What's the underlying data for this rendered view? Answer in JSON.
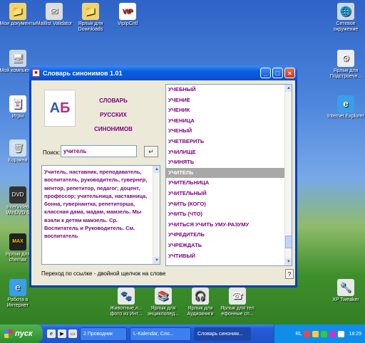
{
  "desktop": {
    "icons": [
      {
        "label": "Мои документы",
        "icon": "folder-icon"
      },
      {
        "label": "Maillist Validator",
        "icon": "app-icon"
      },
      {
        "label": "Ярлык для Downloads",
        "icon": "folder-icon"
      },
      {
        "label": "VipIpCntl",
        "icon": "app-icon"
      },
      {
        "label": "Мой компьютер",
        "icon": "computer-icon"
      },
      {
        "label": "Игры",
        "icon": "app-icon"
      },
      {
        "label": "Корзина",
        "icon": "recycle-bin-icon"
      },
      {
        "label": "InterVideo WinDVD 5",
        "icon": "dvd-icon"
      },
      {
        "label": "Ярлык для chemax",
        "icon": "app-icon"
      },
      {
        "label": "Работа в Интернет",
        "icon": "internet-icon"
      },
      {
        "label": "Сетевое окружение",
        "icon": "network-icon"
      },
      {
        "label": "Ярлык для Подстроечн...",
        "icon": "app-icon"
      },
      {
        "label": "Internet Explorer",
        "icon": "ie-icon"
      },
      {
        "label": "XP Tweaker",
        "icon": "app-icon"
      },
      {
        "label": "Животные,л... фото из Инт...",
        "icon": "app-icon"
      },
      {
        "label": "Ярлык для энциклопед...",
        "icon": "app-icon"
      },
      {
        "label": "Ярлык для Аудиокниги",
        "icon": "app-icon"
      },
      {
        "label": "Ярлык для тел ефонные сп...",
        "icon": "app-icon"
      }
    ]
  },
  "window": {
    "title": "Словарь синонимов 1.01",
    "app_title_lines": [
      "СЛОВАРЬ",
      "РУССКИХ",
      "СИНОНИМОВ"
    ],
    "search": {
      "label": "Поиск:",
      "value": "учитель"
    },
    "definition": "Учитель, наставник, преподаватель, воспитатель, руководитель, гувернер, ментор, репетитор, педагог; доцент, профессор; учительница, наставница, бонна, гувернантка, репетиторша, классная дама, мадам, мамзель. Мы взяли к детям мамзель. Ср. Воспитатель и Руководитель. См. воспитатель",
    "words": [
      "УЧЕБНЫЙ",
      "УЧЕНИЕ",
      "УЧЕНИК",
      "УЧЕНИЦА",
      "УЧЕНЫЙ",
      "УЧЕТВЕРИТЬ",
      "УЧИЛИЩЕ",
      "УЧИНЯТЬ",
      "УЧИТЕЛЬ",
      "УЧИТЕЛЬНИЦА",
      "УЧИТЕЛЬНЫЙ",
      "УЧИТЬ (КОГО)",
      "УЧИТЬ (ЧТО)",
      "УЧИТЬСЯ УЧИТЬ УМУ-РАЗУМУ",
      "УЧРЕДИТЕЛЬ",
      "УЧРЕЖДАТЬ",
      "УЧТИВЫЙ"
    ],
    "selected_word": "УЧИТЕЛЬ",
    "status": "Переход по ссылке - двойной щелчок на слове",
    "help_label": "?"
  },
  "taskbar": {
    "start_label": "пуск",
    "items": [
      "2 Проводник",
      "L-Kalendar, Сло...",
      "Словарь синоним..."
    ],
    "tray_lang": "RL",
    "clock": "18:29"
  }
}
